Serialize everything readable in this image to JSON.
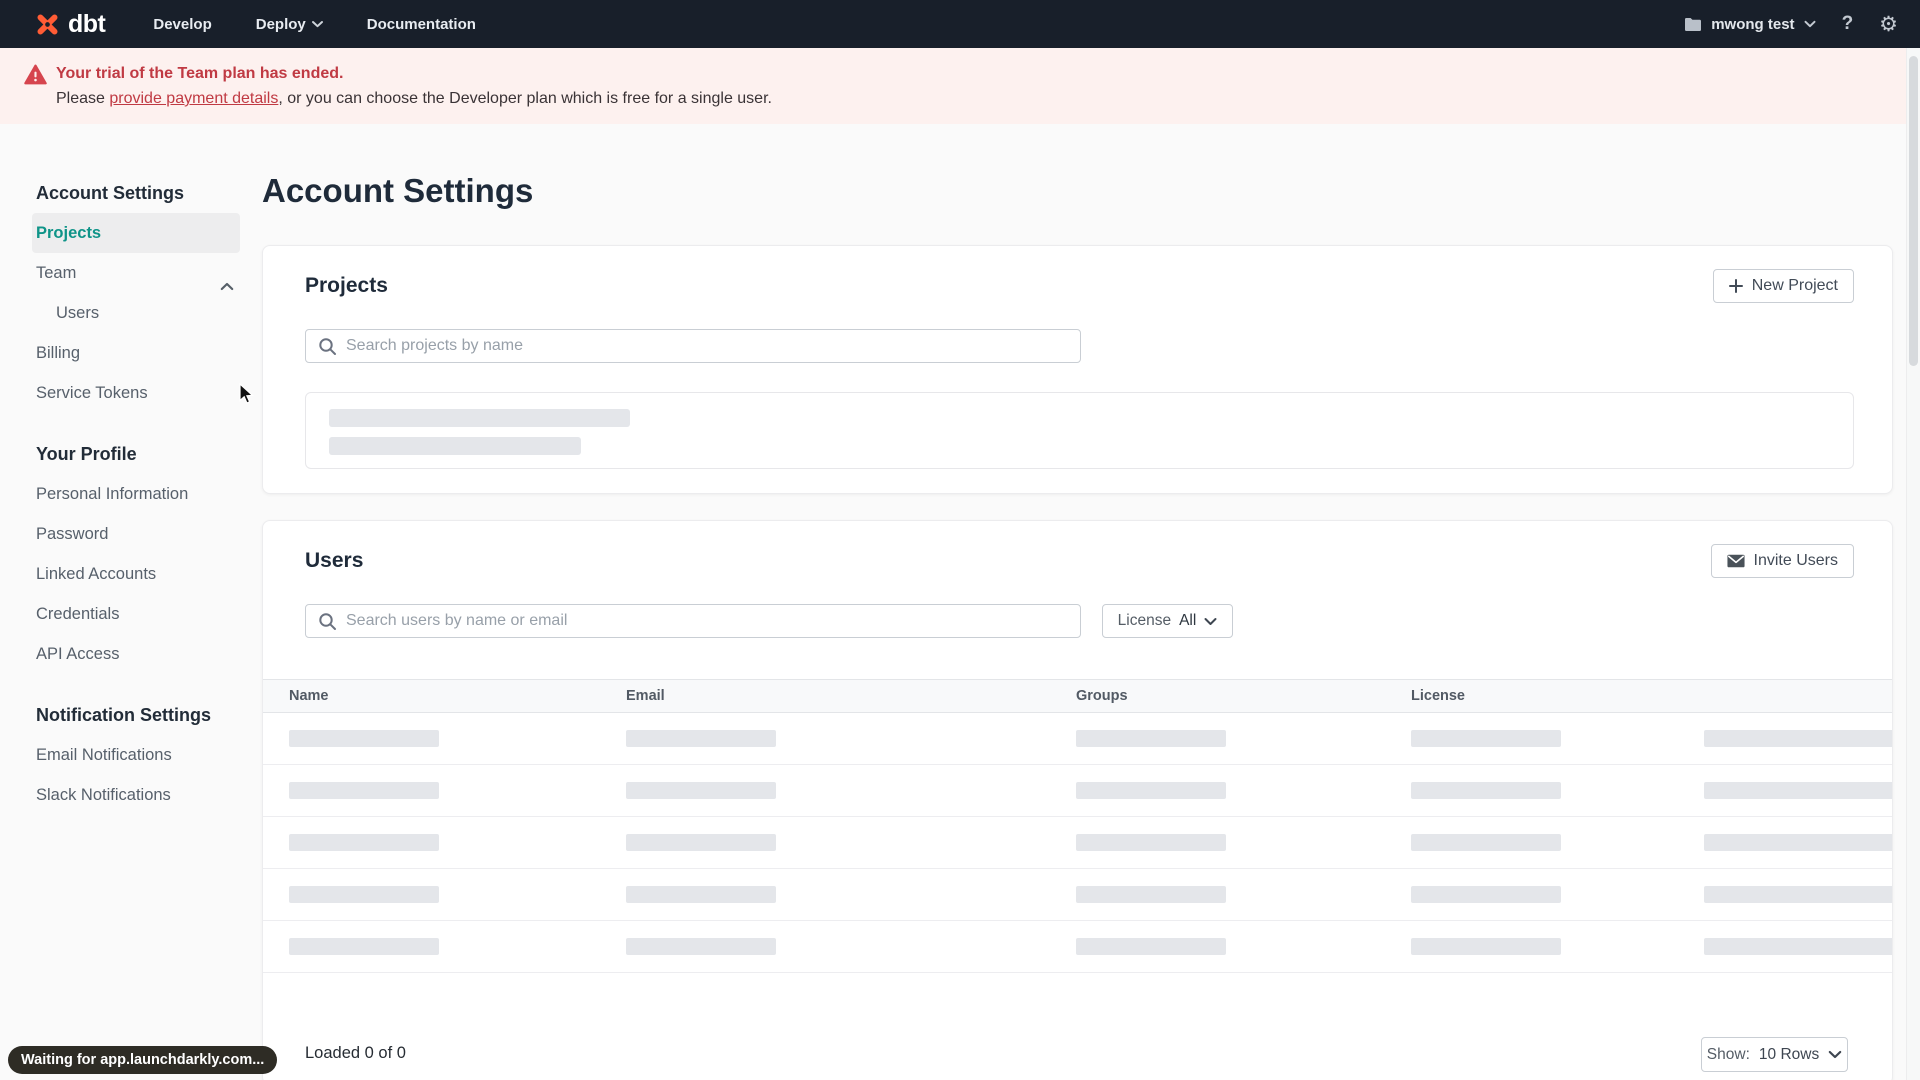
{
  "nav": {
    "brand": "dbt",
    "develop": "Develop",
    "deploy": "Deploy",
    "documentation": "Documentation",
    "account_name": "mwong test"
  },
  "banner": {
    "title": "Your trial of the Team plan has ended.",
    "body_prefix": "Please ",
    "payment_link": "provide payment details",
    "body_suffix": ", or you can choose the Developer plan which is free for a single user."
  },
  "sidebar": {
    "sections": [
      {
        "header": "Account Settings",
        "items": [
          {
            "label": "Projects"
          },
          {
            "label": "Team"
          },
          {
            "label": "Users"
          },
          {
            "label": "Billing"
          },
          {
            "label": "Service Tokens"
          }
        ]
      },
      {
        "header": "Your Profile",
        "items": [
          {
            "label": "Personal Information"
          },
          {
            "label": "Password"
          },
          {
            "label": "Linked Accounts"
          },
          {
            "label": "Credentials"
          },
          {
            "label": "API Access"
          }
        ]
      },
      {
        "header": "Notification Settings",
        "items": [
          {
            "label": "Email Notifications"
          },
          {
            "label": "Slack Notifications"
          }
        ]
      }
    ]
  },
  "main": {
    "page_title": "Account Settings",
    "projects": {
      "title": "Projects",
      "new_project_button": "New Project",
      "search_placeholder": "Search projects by name"
    },
    "users": {
      "title": "Users",
      "invite_button": "Invite Users",
      "search_placeholder": "Search users by name or email",
      "license_label": "License",
      "license_value": "All",
      "columns": [
        "Name",
        "Email",
        "Groups",
        "License"
      ],
      "loaded_text": "Loaded 0 of 0",
      "show_label": "Show:",
      "show_value": "10 Rows"
    }
  },
  "status_bubble": "Waiting for app.launchdarkly.com...",
  "colors": {
    "nav_bg": "#181f2a",
    "brand_orange": "#ff5c35",
    "banner_bg": "#fdf1ef",
    "banner_red": "#c03a43",
    "active_teal": "#0f9488",
    "skeleton": "#e4e6ea"
  }
}
